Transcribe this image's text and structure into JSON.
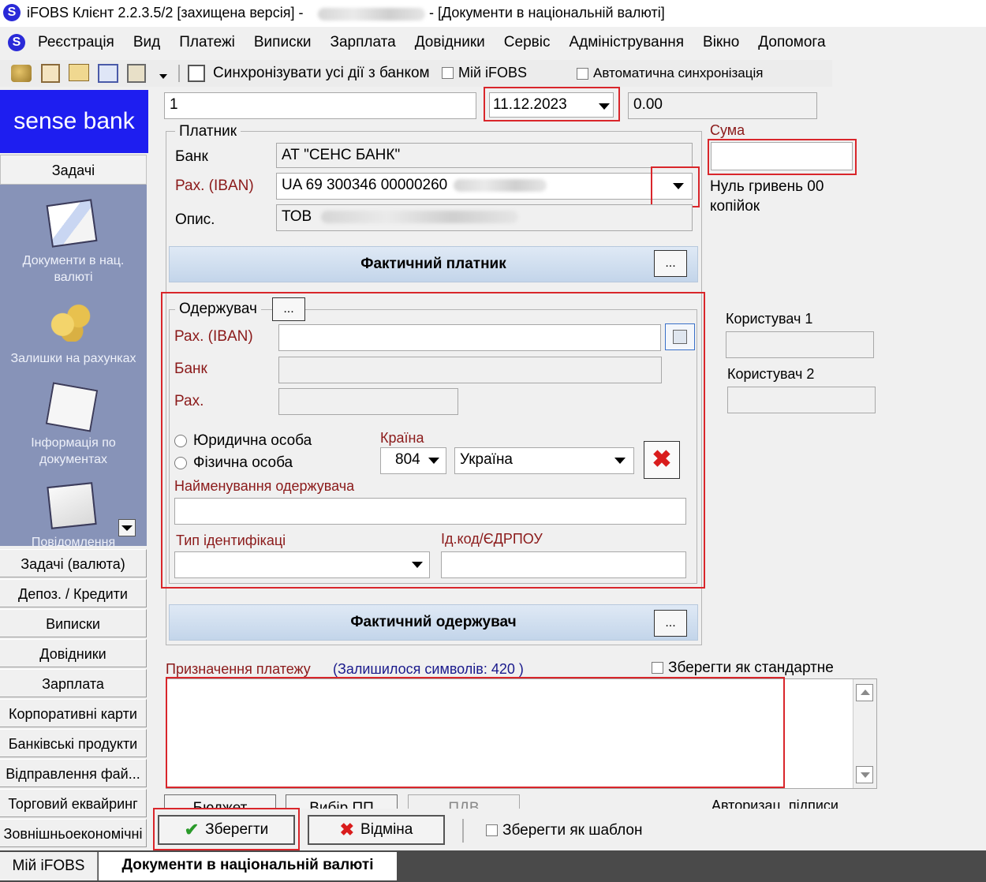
{
  "window": {
    "title_prefix": "iFOBS Клієнт 2.2.3.5/2 [захищена версія] -",
    "title_suffix": "- [Документи в національній валюті]"
  },
  "menu": [
    "Реєстрація",
    "Вид",
    "Платежі",
    "Виписки",
    "Зарплата",
    "Довідники",
    "Сервіс",
    "Адміністрування",
    "Вікно",
    "Допомога"
  ],
  "toolbar": {
    "sync_label": "Синхронізувати усі дії з банком",
    "my_ifobs_label": "Мій iFOBS",
    "auto_sync_label": "Автоматична синхронізація"
  },
  "sidebar": {
    "logo": "sense bank",
    "tasks_header": "Задачі",
    "icons": [
      {
        "label": "Документи в нац. валюті",
        "icon": "documents-icon"
      },
      {
        "label": "Залишки на рахунках",
        "icon": "coins-icon"
      },
      {
        "label": "Інформація по документах",
        "icon": "doc-info-icon"
      },
      {
        "label": "Повідомлення",
        "icon": "messages-icon"
      }
    ],
    "nav": [
      "Задачі (валюта)",
      "Депоз. / Кредити",
      "Виписки",
      "Довідники",
      "Зарплата",
      "Корпоративні карти",
      "Банківські продукти",
      "Відправлення фай...",
      "Торговий еквайринг",
      "Зовнішньоекономічні"
    ]
  },
  "form": {
    "doc_number": "1",
    "date": "11.12.2023",
    "amount_total": "0.00",
    "payer": {
      "group_label": "Платник",
      "bank_label": "Банк",
      "bank_value": "АТ \"СЕНС БАНК\"",
      "iban_label": "Рах. (IBAN)",
      "iban_value": "UA 69 300346 00000260",
      "desc_label": "Опис.",
      "desc_value": "ТОВ"
    },
    "sum": {
      "label": "Сума",
      "value": "",
      "in_words": "Нуль гривень 00 копійок"
    },
    "actual_payer_label": "Фактичний платник",
    "recipient": {
      "group_label": "Одержувач",
      "iban_label": "Рах. (IBAN)",
      "bank_label": "Банк",
      "account_label": "Рах.",
      "legal_label": "Юридична особа",
      "physical_label": "Фізична особа",
      "country_label": "Країна",
      "country_code": "804",
      "country_name": "Україна",
      "name_label": "Найменування одержувача",
      "id_type_label": "Тип ідентифікаці",
      "id_code_label": "Ід.код/ЄДРПОУ"
    },
    "user1_label": "Користувач 1",
    "user2_label": "Користувач 2",
    "actual_recipient_label": "Фактичний одержувач",
    "purpose": {
      "label": "Призначення платежу",
      "remaining": "(Залишилося символів: 420 )",
      "save_standard_label": "Зберегти як стандартне"
    },
    "partial_buttons": [
      "Бюджет",
      "Вибір ПП",
      "ПДВ",
      "Авторизац. підписи"
    ],
    "save_label": "Зберегти",
    "cancel_label": "Відміна",
    "save_template_label": "Зберегти як шаблон",
    "dots": "..."
  },
  "tabs": [
    "Мій iFOBS",
    "Документи в національній валюті"
  ],
  "colors": {
    "brand": "#1a1aee",
    "sidebar": "#8793b8",
    "highlight": "#d9262b",
    "label_red": "#8b1a1a",
    "link_blue": "#1a1a8c"
  }
}
